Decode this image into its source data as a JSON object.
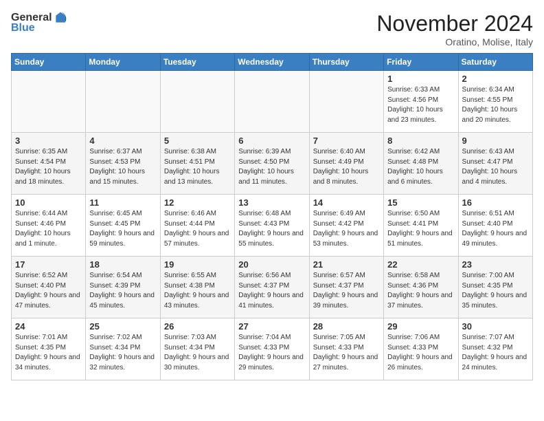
{
  "header": {
    "logo_general": "General",
    "logo_blue": "Blue",
    "month_title": "November 2024",
    "location": "Oratino, Molise, Italy"
  },
  "weekdays": [
    "Sunday",
    "Monday",
    "Tuesday",
    "Wednesday",
    "Thursday",
    "Friday",
    "Saturday"
  ],
  "weeks": [
    [
      {
        "day": "",
        "info": ""
      },
      {
        "day": "",
        "info": ""
      },
      {
        "day": "",
        "info": ""
      },
      {
        "day": "",
        "info": ""
      },
      {
        "day": "",
        "info": ""
      },
      {
        "day": "1",
        "info": "Sunrise: 6:33 AM\nSunset: 4:56 PM\nDaylight: 10 hours and 23 minutes."
      },
      {
        "day": "2",
        "info": "Sunrise: 6:34 AM\nSunset: 4:55 PM\nDaylight: 10 hours and 20 minutes."
      }
    ],
    [
      {
        "day": "3",
        "info": "Sunrise: 6:35 AM\nSunset: 4:54 PM\nDaylight: 10 hours and 18 minutes."
      },
      {
        "day": "4",
        "info": "Sunrise: 6:37 AM\nSunset: 4:53 PM\nDaylight: 10 hours and 15 minutes."
      },
      {
        "day": "5",
        "info": "Sunrise: 6:38 AM\nSunset: 4:51 PM\nDaylight: 10 hours and 13 minutes."
      },
      {
        "day": "6",
        "info": "Sunrise: 6:39 AM\nSunset: 4:50 PM\nDaylight: 10 hours and 11 minutes."
      },
      {
        "day": "7",
        "info": "Sunrise: 6:40 AM\nSunset: 4:49 PM\nDaylight: 10 hours and 8 minutes."
      },
      {
        "day": "8",
        "info": "Sunrise: 6:42 AM\nSunset: 4:48 PM\nDaylight: 10 hours and 6 minutes."
      },
      {
        "day": "9",
        "info": "Sunrise: 6:43 AM\nSunset: 4:47 PM\nDaylight: 10 hours and 4 minutes."
      }
    ],
    [
      {
        "day": "10",
        "info": "Sunrise: 6:44 AM\nSunset: 4:46 PM\nDaylight: 10 hours and 1 minute."
      },
      {
        "day": "11",
        "info": "Sunrise: 6:45 AM\nSunset: 4:45 PM\nDaylight: 9 hours and 59 minutes."
      },
      {
        "day": "12",
        "info": "Sunrise: 6:46 AM\nSunset: 4:44 PM\nDaylight: 9 hours and 57 minutes."
      },
      {
        "day": "13",
        "info": "Sunrise: 6:48 AM\nSunset: 4:43 PM\nDaylight: 9 hours and 55 minutes."
      },
      {
        "day": "14",
        "info": "Sunrise: 6:49 AM\nSunset: 4:42 PM\nDaylight: 9 hours and 53 minutes."
      },
      {
        "day": "15",
        "info": "Sunrise: 6:50 AM\nSunset: 4:41 PM\nDaylight: 9 hours and 51 minutes."
      },
      {
        "day": "16",
        "info": "Sunrise: 6:51 AM\nSunset: 4:40 PM\nDaylight: 9 hours and 49 minutes."
      }
    ],
    [
      {
        "day": "17",
        "info": "Sunrise: 6:52 AM\nSunset: 4:40 PM\nDaylight: 9 hours and 47 minutes."
      },
      {
        "day": "18",
        "info": "Sunrise: 6:54 AM\nSunset: 4:39 PM\nDaylight: 9 hours and 45 minutes."
      },
      {
        "day": "19",
        "info": "Sunrise: 6:55 AM\nSunset: 4:38 PM\nDaylight: 9 hours and 43 minutes."
      },
      {
        "day": "20",
        "info": "Sunrise: 6:56 AM\nSunset: 4:37 PM\nDaylight: 9 hours and 41 minutes."
      },
      {
        "day": "21",
        "info": "Sunrise: 6:57 AM\nSunset: 4:37 PM\nDaylight: 9 hours and 39 minutes."
      },
      {
        "day": "22",
        "info": "Sunrise: 6:58 AM\nSunset: 4:36 PM\nDaylight: 9 hours and 37 minutes."
      },
      {
        "day": "23",
        "info": "Sunrise: 7:00 AM\nSunset: 4:35 PM\nDaylight: 9 hours and 35 minutes."
      }
    ],
    [
      {
        "day": "24",
        "info": "Sunrise: 7:01 AM\nSunset: 4:35 PM\nDaylight: 9 hours and 34 minutes."
      },
      {
        "day": "25",
        "info": "Sunrise: 7:02 AM\nSunset: 4:34 PM\nDaylight: 9 hours and 32 minutes."
      },
      {
        "day": "26",
        "info": "Sunrise: 7:03 AM\nSunset: 4:34 PM\nDaylight: 9 hours and 30 minutes."
      },
      {
        "day": "27",
        "info": "Sunrise: 7:04 AM\nSunset: 4:33 PM\nDaylight: 9 hours and 29 minutes."
      },
      {
        "day": "28",
        "info": "Sunrise: 7:05 AM\nSunset: 4:33 PM\nDaylight: 9 hours and 27 minutes."
      },
      {
        "day": "29",
        "info": "Sunrise: 7:06 AM\nSunset: 4:33 PM\nDaylight: 9 hours and 26 minutes."
      },
      {
        "day": "30",
        "info": "Sunrise: 7:07 AM\nSunset: 4:32 PM\nDaylight: 9 hours and 24 minutes."
      }
    ]
  ]
}
